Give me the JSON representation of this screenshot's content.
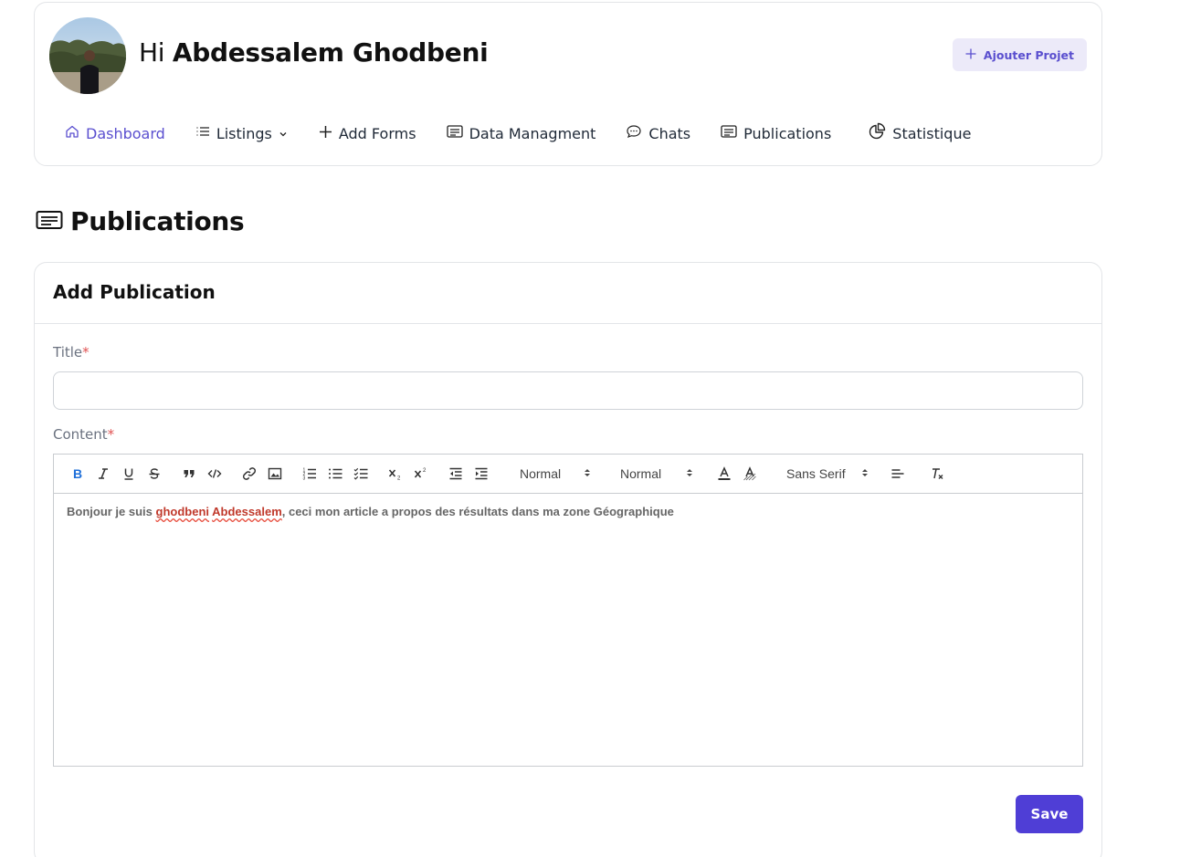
{
  "header": {
    "greeting_prefix": "Hi",
    "user_name": "Abdessalem Ghodbeni",
    "add_project_label": "Ajouter Projet"
  },
  "nav": {
    "items": [
      {
        "label": "Dashboard",
        "icon": "home-icon",
        "active": true
      },
      {
        "label": "Listings",
        "icon": "list-icon"
      },
      {
        "label": "Add Forms",
        "icon": "plus-icon"
      },
      {
        "label": "Data Managment",
        "icon": "document-icon"
      },
      {
        "label": "Chats",
        "icon": "chat-bubble-icon"
      },
      {
        "label": "Publications",
        "icon": "document-icon"
      },
      {
        "label": "Statistique",
        "icon": "pie-chart-icon"
      }
    ]
  },
  "page": {
    "title": "Publications"
  },
  "form": {
    "card_title": "Add Publication",
    "title_label": "Title",
    "required_mark": "*",
    "title_value": "",
    "content_label": "Content",
    "toolbar": {
      "header_select": "Normal",
      "size_select": "Normal",
      "font_select": "Sans Serif"
    },
    "content": {
      "before": "Bonjour je suis ",
      "misspelled_1": "ghodbeni",
      "space": " ",
      "misspelled_2": "Abdessalem",
      "after": ", ceci mon article a propos des résultats dans ma zone Géographique"
    },
    "save_label": "Save"
  },
  "colors": {
    "accent": "#5a4fcf",
    "primary_button": "#4f3ed6",
    "required": "#e05252",
    "misspelled": "#c0392b"
  }
}
